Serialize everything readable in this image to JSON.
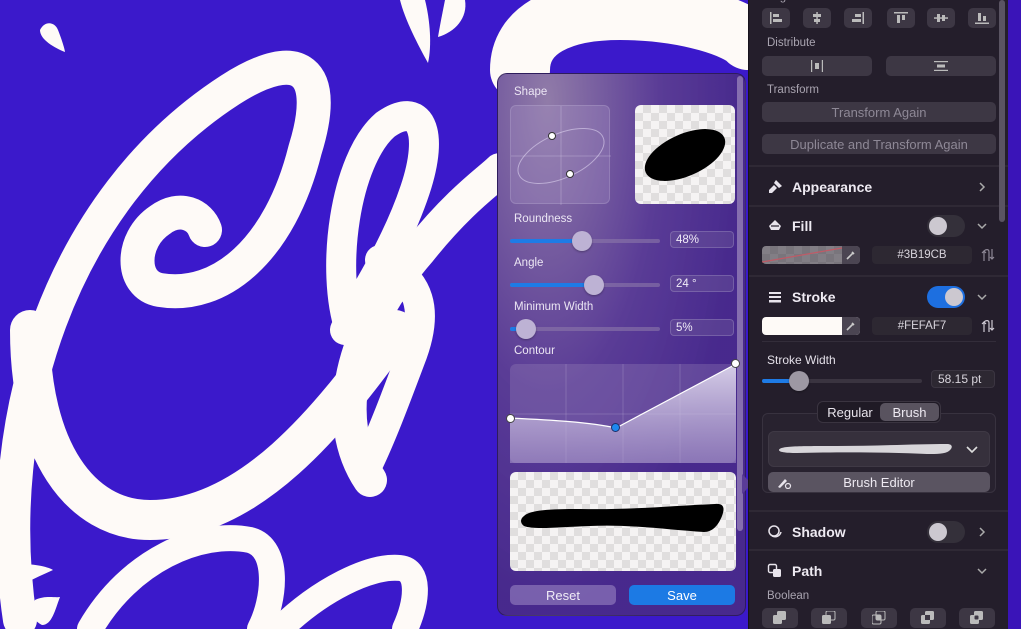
{
  "canvas": {
    "background_color": "#3B19CB",
    "artwork_color": "#FEFAF7",
    "description": "Script lettering artwork"
  },
  "popover": {
    "shape_label": "Shape",
    "roundness_label": "Roundness",
    "roundness_value": "48%",
    "roundness_fraction": 0.48,
    "angle_label": "Angle",
    "angle_value": "24 °",
    "angle_fraction": 0.55,
    "min_width_label": "Minimum Width",
    "min_width_value": "5%",
    "min_width_fraction": 0.05,
    "contour_label": "Contour",
    "reset_label": "Reset",
    "save_label": "Save"
  },
  "inspector": {
    "align_label": "Align",
    "align_buttons": [
      "align-left",
      "align-center-horizontal",
      "align-right",
      "align-top",
      "align-center-vertical",
      "align-bottom"
    ],
    "distribute_label": "Distribute",
    "distribute_buttons": [
      "distribute-horizontal",
      "distribute-vertical"
    ],
    "transform_label": "Transform",
    "transform_again_label": "Transform Again",
    "duplicate_transform_label": "Duplicate and Transform Again",
    "appearance": {
      "label": "Appearance"
    },
    "fill": {
      "label": "Fill",
      "enabled": false,
      "hex": "#3B19CB"
    },
    "stroke": {
      "label": "Stroke",
      "enabled": true,
      "hex": "#FEFAF7",
      "width_label": "Stroke Width",
      "width_value": "58.15 pt",
      "width_fraction": 0.22
    },
    "stroke_type": {
      "options": [
        "Regular",
        "Brush"
      ],
      "selected": "Brush"
    },
    "brush_editor_label": "Brush Editor",
    "shadow": {
      "label": "Shadow",
      "enabled": false
    },
    "path": {
      "label": "Path",
      "boolean_label": "Boolean",
      "boolean_buttons": [
        "union",
        "subtract",
        "intersect",
        "difference",
        "exclude"
      ]
    },
    "accent_color": "#1D6FE0"
  }
}
